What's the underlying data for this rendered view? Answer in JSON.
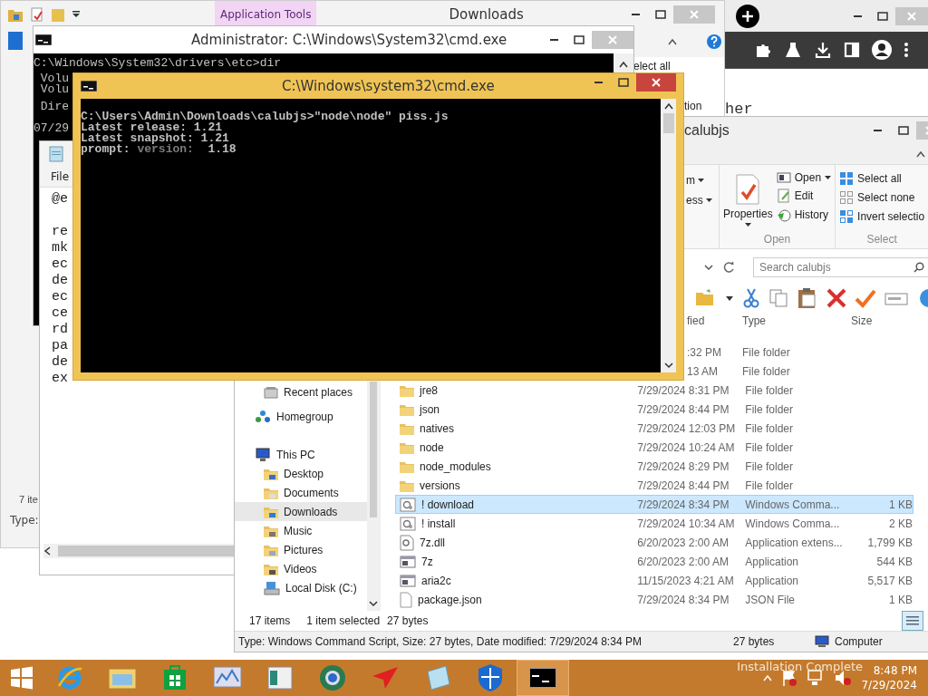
{
  "downloads_window": {
    "title": "Downloads",
    "context_tab": "Application Tools",
    "ribbon_fragments": [
      "elect all",
      "tion"
    ],
    "status_count": "7 ite",
    "status_type": "Type:"
  },
  "browser": {
    "content_fragment": "her"
  },
  "admin_cmd": {
    "title": "Administrator: C:\\Windows\\System32\\cmd.exe",
    "blocks": [
      [
        "C:\\Windows\\System32\\drivers\\etc>dir",
        " Volu",
        " Volu"
      ],
      [
        " Dire"
      ],
      [
        "07/29"
      ]
    ]
  },
  "notepad": {
    "menu": [
      "File"
    ],
    "blocks": [
      [
        "@e"
      ],
      [
        "re",
        "mk",
        "ec",
        "de",
        "ec",
        "ce",
        "rd",
        "pa",
        "de",
        "ex"
      ]
    ]
  },
  "explorer": {
    "title": "calubjs",
    "ribbon": {
      "fragments": [
        "m",
        "ess"
      ],
      "properties": "Properties",
      "open_items": [
        {
          "label": "Open",
          "kind": "open"
        },
        {
          "label": "Edit",
          "kind": "edit"
        },
        {
          "label": "History",
          "kind": "history"
        }
      ],
      "select_items": [
        {
          "label": "Select all",
          "kind": "all"
        },
        {
          "label": "Select none",
          "kind": "none"
        },
        {
          "label": "Invert selectio",
          "kind": "invert"
        }
      ],
      "groups": [
        "Open",
        "Select"
      ]
    },
    "search": {
      "placeholder": "Search calubjs"
    },
    "columns": [
      "fied",
      "Type",
      "Size"
    ],
    "nav": [
      {
        "label": "Recent places",
        "kind": "recent",
        "selected": false
      },
      {
        "label": "Homegroup",
        "kind": "homegroup",
        "selected": false
      },
      {
        "label": "This PC",
        "kind": "pc",
        "selected": false,
        "children": [
          {
            "label": "Desktop",
            "kind": "desktop",
            "selected": false
          },
          {
            "label": "Documents",
            "kind": "documents",
            "selected": false
          },
          {
            "label": "Downloads",
            "kind": "downloads",
            "selected": true
          },
          {
            "label": "Music",
            "kind": "music",
            "selected": false
          },
          {
            "label": "Pictures",
            "kind": "pictures",
            "selected": false
          },
          {
            "label": "Videos",
            "kind": "videos",
            "selected": false
          },
          {
            "label": "Local Disk (C:)",
            "kind": "disk",
            "selected": false
          }
        ]
      }
    ],
    "files": [
      {
        "date": ":32 PM",
        "type": "File folder",
        "kind": "covered",
        "selected": false
      },
      {
        "date": "13 AM",
        "type": "File folder",
        "kind": "covered",
        "selected": false
      },
      {
        "name": "jre8",
        "date": "7/29/2024 8:31 PM",
        "type": "File folder",
        "kind": "folder",
        "selected": false
      },
      {
        "name": "json",
        "date": "7/29/2024 8:44 PM",
        "type": "File folder",
        "kind": "folder",
        "selected": false
      },
      {
        "name": "natives",
        "date": "7/29/2024 12:03 PM",
        "type": "File folder",
        "kind": "folder",
        "selected": false
      },
      {
        "name": "node",
        "date": "7/29/2024 10:24 AM",
        "type": "File folder",
        "kind": "folder",
        "selected": false
      },
      {
        "name": "node_modules",
        "date": "7/29/2024 8:29 PM",
        "type": "File folder",
        "kind": "folder",
        "selected": false
      },
      {
        "name": "versions",
        "date": "7/29/2024 8:44 PM",
        "type": "File folder",
        "kind": "folder",
        "selected": false
      },
      {
        "name": "! download",
        "date": "7/29/2024 8:34 PM",
        "type": "Windows Comma...",
        "size": "1 KB",
        "kind": "script",
        "selected": true
      },
      {
        "name": "! install",
        "date": "7/29/2024 10:34 AM",
        "type": "Windows Comma...",
        "size": "2 KB",
        "kind": "script",
        "selected": false
      },
      {
        "name": "7z.dll",
        "date": "6/20/2023 2:00 AM",
        "type": "Application extens...",
        "size": "1,799 KB",
        "kind": "dll",
        "selected": false
      },
      {
        "name": "7z",
        "date": "6/20/2023 2:00 AM",
        "type": "Application",
        "size": "544 KB",
        "kind": "app",
        "selected": false
      },
      {
        "name": "aria2c",
        "date": "11/15/2023 4:21 AM",
        "type": "Application",
        "size": "5,517 KB",
        "kind": "app",
        "selected": false
      },
      {
        "name": "package.json",
        "date": "7/29/2024 8:34 PM",
        "type": "JSON File",
        "size": "1 KB",
        "kind": "json",
        "selected": false
      }
    ],
    "status": {
      "count": "17 items",
      "selection": "1 item selected",
      "size": "27 bytes"
    },
    "details_bar": {
      "text": "Type: Windows Command Script, Size: 27 bytes, Date modified: 7/29/2024 8:34 PM",
      "size": "27 bytes",
      "location": "Computer"
    }
  },
  "cmd": {
    "title": "C:\\Windows\\system32\\cmd.exe",
    "lines": [
      {
        "parts": [
          {
            "text": "C:\\Users\\Admin\\Downloads\\calubjs>\"node\\node\" piss.js",
            "dim": false
          }
        ]
      },
      {
        "parts": [
          {
            "text": "Latest release: 1.21",
            "dim": false
          }
        ]
      },
      {
        "parts": [
          {
            "text": "Latest snapshot: 1.21",
            "dim": false
          }
        ]
      },
      {
        "parts": [
          {
            "text": "prompt: ",
            "dim": false
          },
          {
            "text": "version: ",
            "dim": true
          },
          {
            "text": " 1.18",
            "dim": false
          }
        ]
      }
    ]
  },
  "taskbar": {
    "apps": [
      {
        "kind": "ie",
        "selected": false
      },
      {
        "kind": "explorer",
        "selected": false
      },
      {
        "kind": "store",
        "selected": false
      },
      {
        "kind": "monitor",
        "selected": false
      },
      {
        "kind": "app",
        "selected": false
      },
      {
        "kind": "browser",
        "selected": false
      },
      {
        "kind": "arrow",
        "selected": false
      },
      {
        "kind": "notepad",
        "selected": false
      },
      {
        "kind": "shield",
        "selected": false
      },
      {
        "kind": "cmd",
        "selected": true
      }
    ],
    "notification": "Installation Complete",
    "time": "8:48 PM",
    "date": "7/29/2024"
  }
}
